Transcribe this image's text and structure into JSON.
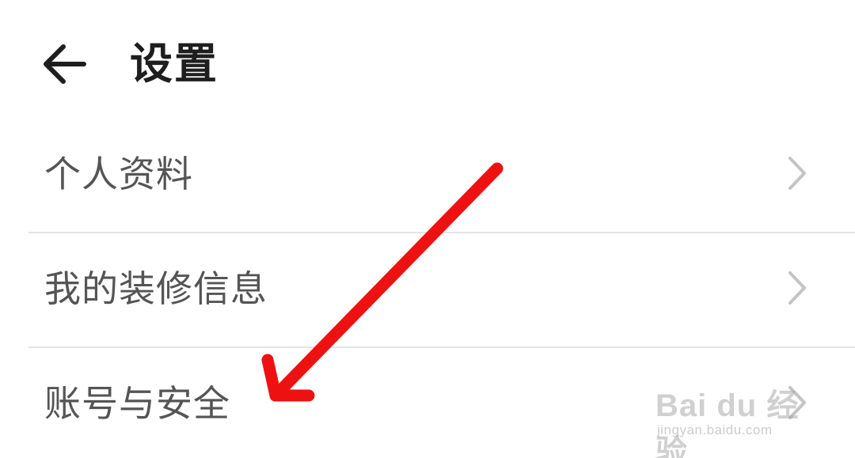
{
  "header": {
    "back_icon": "arrow-left-icon",
    "title": "设置"
  },
  "settings": {
    "items": [
      {
        "label": "个人资料",
        "icon": "chevron-right-icon"
      },
      {
        "label": "我的装修信息",
        "icon": "chevron-right-icon"
      },
      {
        "label": "账号与安全",
        "icon": "chevron-right-icon"
      }
    ]
  },
  "annotation": {
    "arrow_color": "#ee1111"
  },
  "watermark": {
    "logo": "Bai du 经验",
    "url": "jingyan.baidu.com"
  },
  "colors": {
    "title": "#1e1e1e",
    "label": "#555555",
    "chevron": "#c4c4c4",
    "divider": "#e3e3e3"
  }
}
